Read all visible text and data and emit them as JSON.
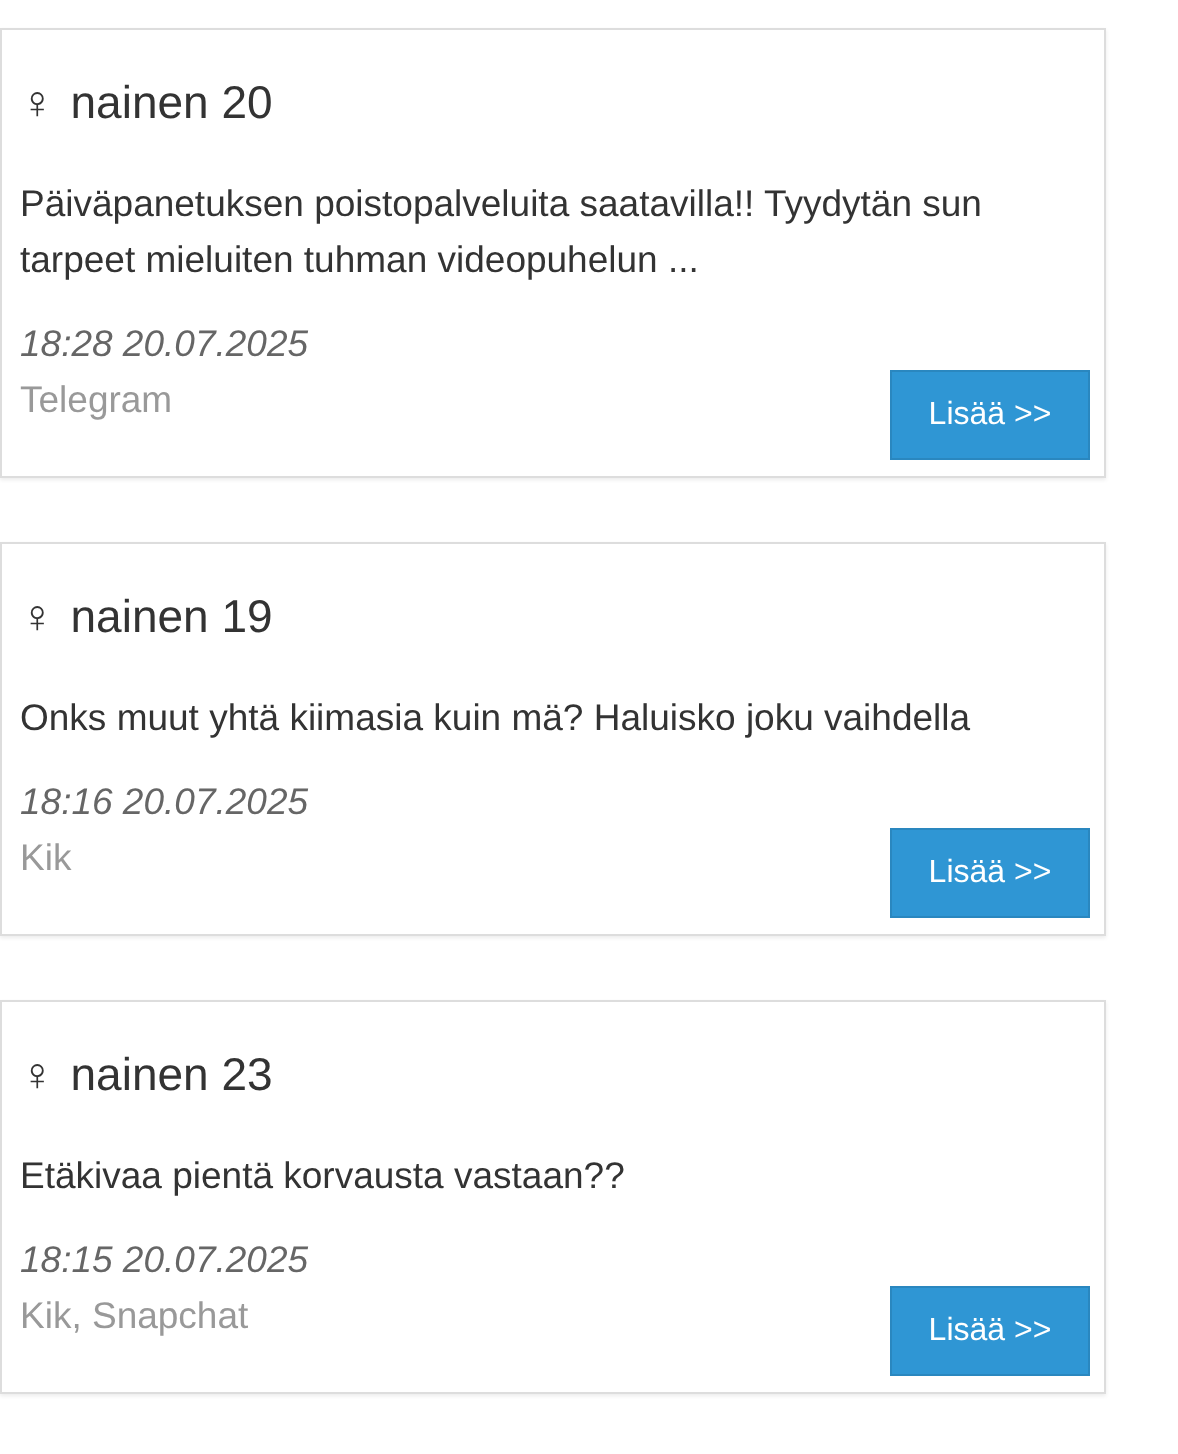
{
  "ads": [
    {
      "symbol": "♀",
      "title": "nainen 20",
      "text": "Päiväpanetuksen poistopalveluita saatavilla!! Tyydytän sun tarpeet mieluiten tuhman videopuhelun ...",
      "time": "18:28 20.07.2025",
      "apps": "Telegram",
      "button": "Lisää >>"
    },
    {
      "symbol": "♀",
      "title": "nainen 19",
      "text": "Onks muut yhtä kiimasia kuin mä? Haluisko joku vaihdella",
      "time": "18:16 20.07.2025",
      "apps": "Kik",
      "button": "Lisää >>"
    },
    {
      "symbol": "♀",
      "title": "nainen 23",
      "text": "Etäkivaa pientä korvausta vastaan??",
      "time": "18:15 20.07.2025",
      "apps": "Kik, Snapchat",
      "button": "Lisää >>"
    }
  ]
}
